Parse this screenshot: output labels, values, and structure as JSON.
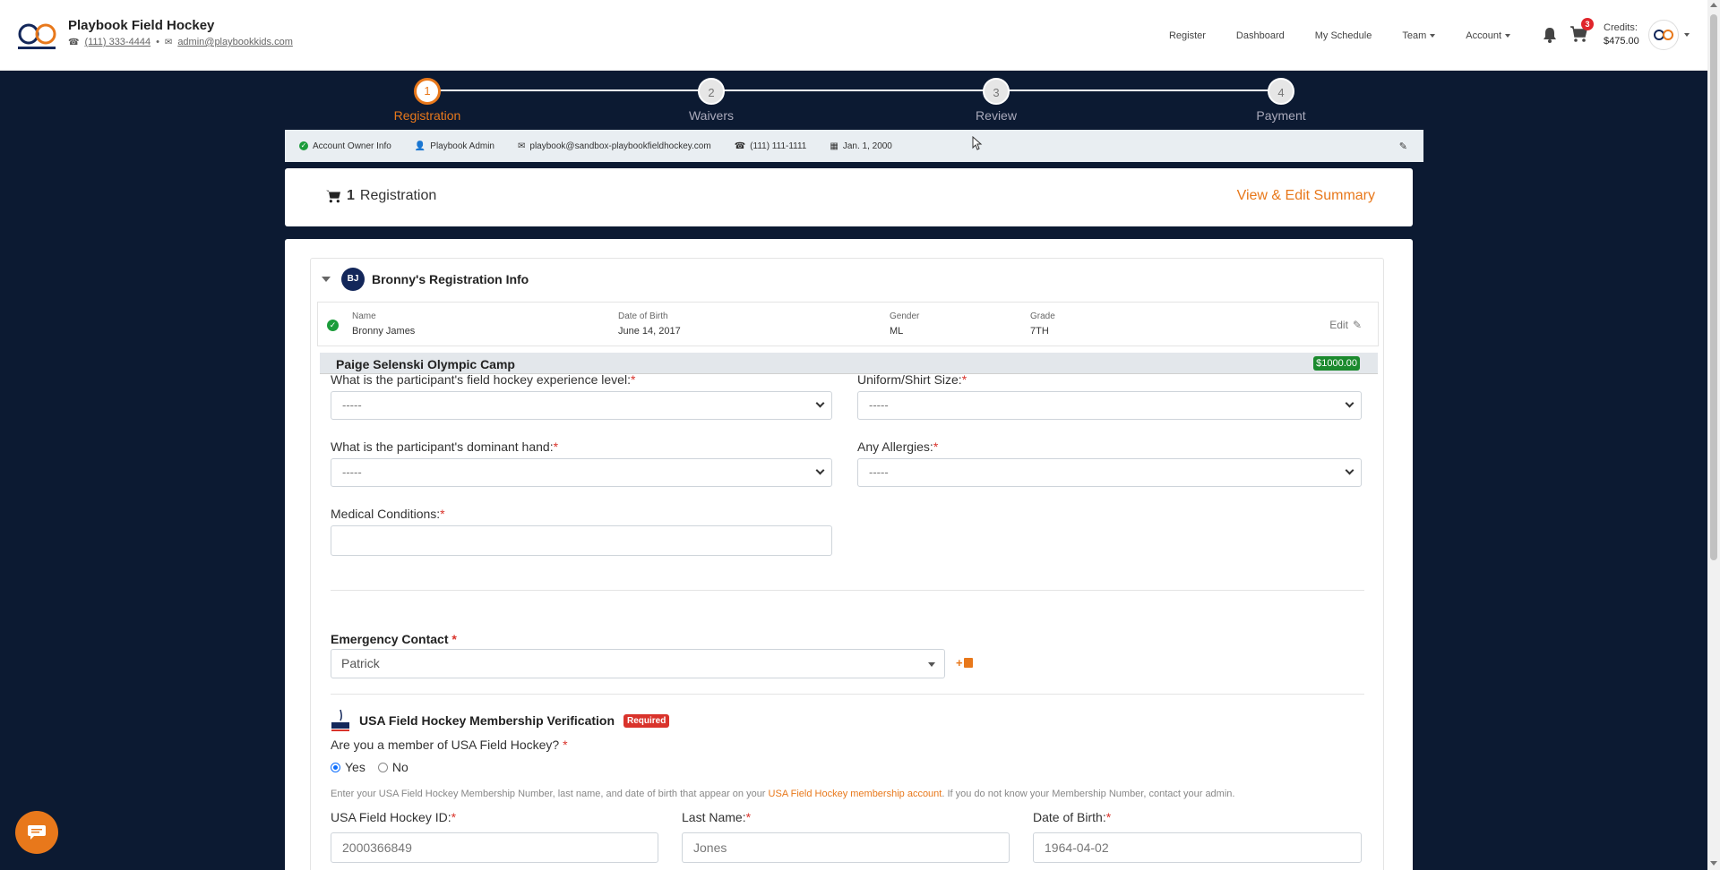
{
  "header": {
    "brand_name": "Playbook Field Hockey",
    "phone": "(111) 333-4444",
    "email": "admin@playbookkids.com",
    "nav": {
      "register": "Register",
      "dashboard": "Dashboard",
      "my_schedule": "My Schedule",
      "team": "Team",
      "account": "Account"
    },
    "cart_count": "3",
    "credits_label": "Credits:",
    "credits_value": "$475.00"
  },
  "stepper": {
    "steps": [
      {
        "num": "1",
        "label": "Registration",
        "active": true
      },
      {
        "num": "2",
        "label": "Waivers"
      },
      {
        "num": "3",
        "label": "Review"
      },
      {
        "num": "4",
        "label": "Payment"
      }
    ]
  },
  "owner": {
    "status": "Account Owner Info",
    "name": "Playbook Admin",
    "email": "playbook@sandbox-playbookfieldhockey.com",
    "phone": "(111) 111-1111",
    "dob": "Jan. 1, 2000"
  },
  "summary": {
    "count": "1",
    "label": "Registration",
    "link": "View & Edit Summary"
  },
  "registration": {
    "initials": "BJ",
    "title": "Bronny's Registration Info",
    "player": {
      "name_label": "Name",
      "name": "Bronny James",
      "dob_label": "Date of Birth",
      "dob": "June 14, 2017",
      "gender_label": "Gender",
      "gender": "ML",
      "grade_label": "Grade",
      "grade": "7TH",
      "edit": "Edit"
    },
    "camp": {
      "name": "Paige Selenski Olympic Camp",
      "price": "$1000.00"
    },
    "fields": {
      "experience_label": "What is the participant's field hockey experience level:",
      "experience_value": "-----",
      "shirt_label": "Uniform/Shirt Size:",
      "shirt_value": "-----",
      "hand_label": "What is the participant's dominant hand:",
      "hand_value": "-----",
      "allergies_label": "Any Allergies:",
      "allergies_value": "-----",
      "medical_label": "Medical Conditions:",
      "medical_value": ""
    },
    "emergency": {
      "label": "Emergency Contact",
      "value": "Patrick"
    },
    "usa": {
      "title": "USA Field Hockey Membership Verification",
      "badge": "Required",
      "question": "Are you a member of USA Field Hockey?",
      "yes": "Yes",
      "no": "No",
      "help_pre": "Enter your USA Field Hockey Membership Number, last name, and date of birth that appear on your",
      "help_link": "USA Field Hockey membership account",
      "help_post": ". If you do not know your Membership Number, contact your admin.",
      "id_label": "USA Field Hockey ID:",
      "id_value": "2000366849",
      "last_label": "Last Name:",
      "last_value": "Jones",
      "dob_label": "Date of Birth:",
      "dob_value": "1964-04-02"
    }
  },
  "colors": {
    "accent": "#e8781b",
    "navy": "#0c1a32",
    "success": "#1b8a2e",
    "danger": "#d9332b"
  },
  "icons": [
    "phone-icon",
    "envelope-icon",
    "bell-icon",
    "cart-icon",
    "user-icon",
    "pencil-icon",
    "chat-icon",
    "check-icon",
    "calendar-icon"
  ]
}
